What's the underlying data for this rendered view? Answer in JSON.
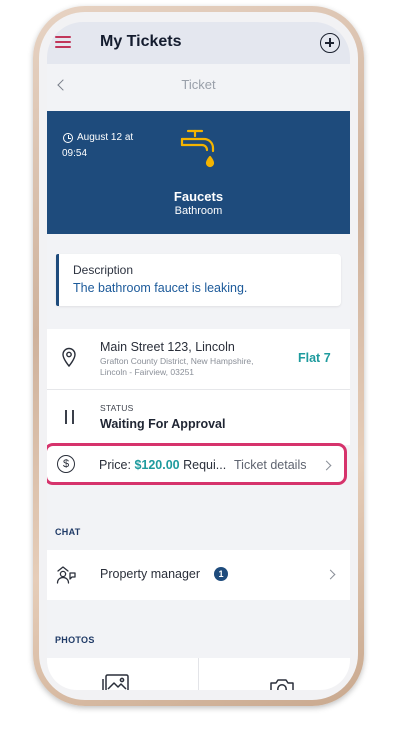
{
  "header": {
    "title": "My Tickets",
    "menu_icon": "hamburger-menu-icon",
    "add_icon": "add-circle-icon"
  },
  "subheader": {
    "title": "Ticket",
    "back_icon": "chevron-left-icon"
  },
  "ticket": {
    "date": "August 12 at",
    "time": "09:54",
    "title": "Faucets",
    "category": "Bathroom",
    "icon": "faucet-icon",
    "hero_color": "#1e4b7c",
    "icon_color": "#f4b400"
  },
  "description": {
    "label": "Description",
    "value": "The bathroom faucet is leaking."
  },
  "address": {
    "line1": "Main Street 123, Lincoln",
    "line2": "Grafton County District, New Hampshire,",
    "line3": "Lincoln - Fairview, 03251",
    "unit": "Flat 7"
  },
  "status": {
    "label": "STATUS",
    "value": "Waiting For Approval"
  },
  "price": {
    "prefix": "Price:",
    "amount": "$120.00",
    "suffix": "Requi...",
    "details": "Ticket details",
    "highlight_color": "#d6336c"
  },
  "chat": {
    "section": "CHAT",
    "contact": "Property manager",
    "unread": "1"
  },
  "photos": {
    "section": "PHOTOS"
  }
}
